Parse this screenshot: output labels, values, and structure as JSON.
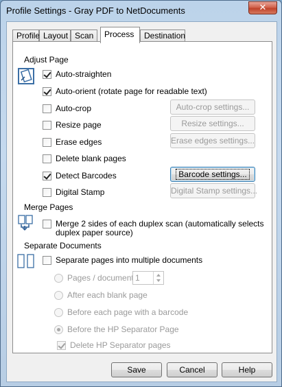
{
  "window": {
    "title": "Profile Settings - Gray PDF to NetDocuments",
    "close_label": "✕"
  },
  "tabs": [
    "Profile",
    "Layout",
    "Scan",
    "Process",
    "Destination"
  ],
  "active_tab": "Process",
  "adjust_page": {
    "label": "Adjust Page",
    "options": {
      "auto_straighten": {
        "label": "Auto-straighten",
        "checked": true
      },
      "auto_orient": {
        "label": "Auto-orient (rotate page for readable text)",
        "checked": true
      },
      "auto_crop": {
        "label": "Auto-crop",
        "checked": false,
        "button": "Auto-crop settings..."
      },
      "resize_page": {
        "label": "Resize page",
        "checked": false,
        "button": "Resize settings..."
      },
      "erase_edges": {
        "label": "Erase edges",
        "checked": false,
        "button": "Erase edges settings..."
      },
      "delete_blank": {
        "label": "Delete blank pages",
        "checked": false
      },
      "detect_barcodes": {
        "label": "Detect Barcodes",
        "checked": true,
        "button": "Barcode settings..."
      },
      "digital_stamp": {
        "label": "Digital Stamp",
        "checked": false,
        "button": "Digital Stamp settings..."
      }
    }
  },
  "merge_pages": {
    "label": "Merge Pages",
    "option_line1": "Merge 2 sides of each duplex scan (automatically selects",
    "option_line2": "duplex paper source)",
    "checked": false
  },
  "separate_documents": {
    "label": "Separate Documents",
    "option": "Separate pages into multiple documents",
    "checked": false,
    "pages_per_doc_label": "Pages / document:",
    "pages_per_doc_value": "1",
    "after_blank": "After each blank page",
    "before_barcode": "Before each page with a barcode",
    "before_hp": "Before the HP Separator Page",
    "delete_hp": "Delete HP Separator pages",
    "selected_radio": "before_hp",
    "delete_hp_checked": true
  },
  "footer": {
    "save": "Save",
    "cancel": "Cancel",
    "help": "Help"
  }
}
